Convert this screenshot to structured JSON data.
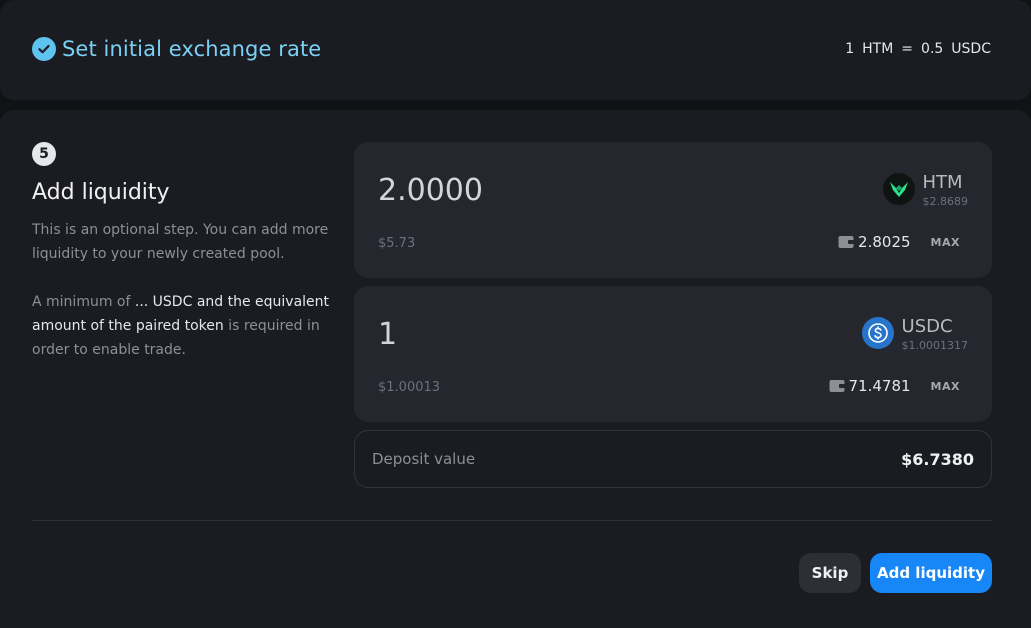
{
  "exchange_rate_step": {
    "title": "Set initial exchange rate",
    "rate": {
      "left_amount": "1",
      "left_token": "HTM",
      "equals": "=",
      "right_amount": "0.5",
      "right_token": "USDC"
    }
  },
  "liquidity_step": {
    "step_number": "5",
    "title": "Add liquidity",
    "description": "This is an optional step. You can add more liquidity to your newly created pool.",
    "minimum_note": {
      "prefix": "A minimum of ",
      "highlight": "... USDC and the equivalent amount of the paired token",
      "suffix": " is required in order to enable trade."
    }
  },
  "tokens": [
    {
      "symbol": "HTM",
      "amount": "2.0000",
      "amount_usd": "$5.73",
      "unit_price": "$2.8689",
      "balance": "2.8025",
      "max_label": "MAX",
      "logo_icon": "htm-logo-icon",
      "logo_color": "#0e1411",
      "accent_color": "#2fe08a"
    },
    {
      "symbol": "USDC",
      "amount": "1",
      "amount_usd": "$1.00013",
      "unit_price": "$1.0001317",
      "balance": "71.4781",
      "max_label": "MAX",
      "logo_icon": "usdc-logo-icon",
      "logo_color": "#2775ca",
      "accent_color": "#ffffff"
    }
  ],
  "deposit": {
    "label": "Deposit value",
    "value": "$6.7380"
  },
  "actions": {
    "skip_label": "Skip",
    "add_label": "Add liquidity"
  },
  "colors": {
    "primary_button": "#1786f7",
    "completed_step": "#5ec3ef"
  }
}
